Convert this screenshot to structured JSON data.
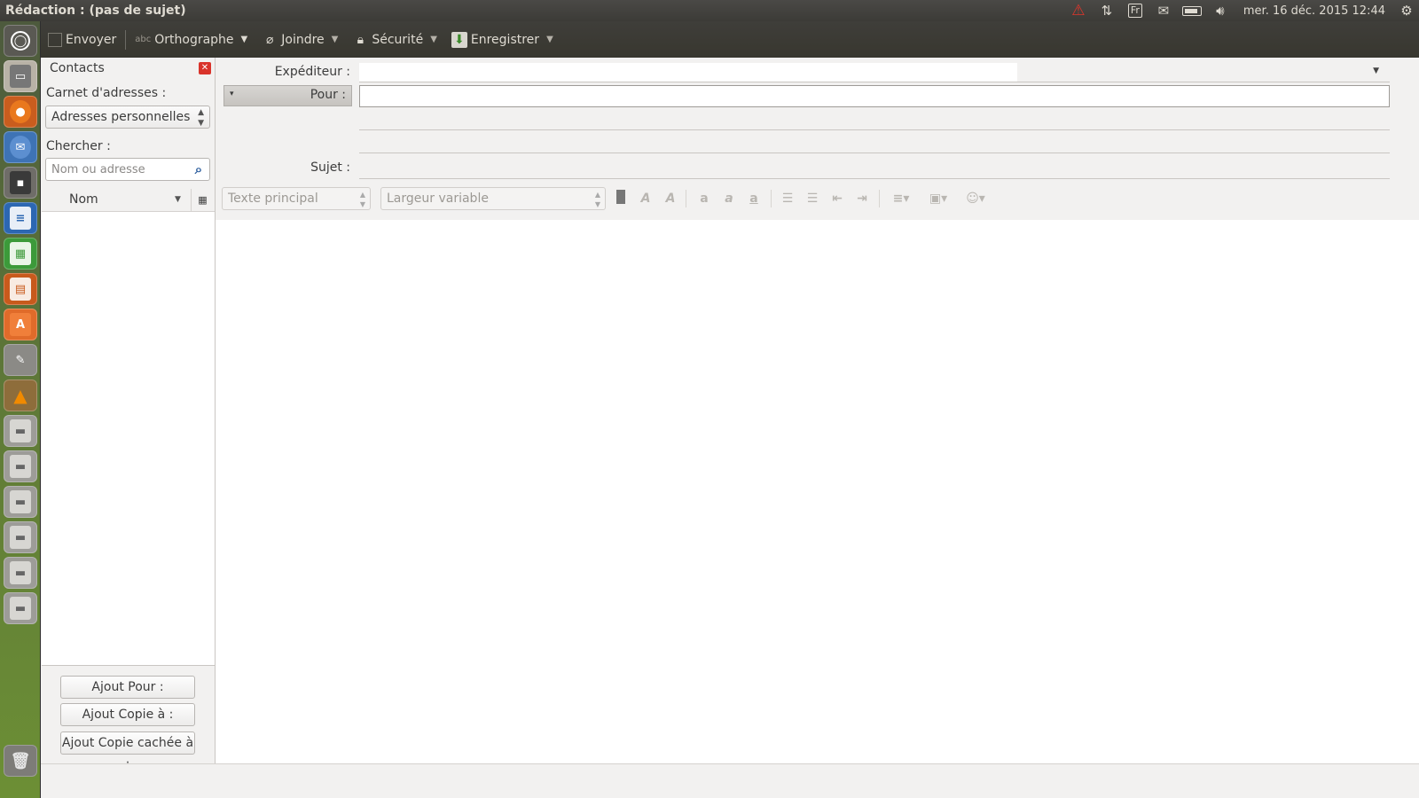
{
  "window": {
    "title": "Rédaction : (pas de sujet)"
  },
  "panel": {
    "keyboard_layout": "Fr",
    "clock": "mer. 16 déc. 2015 12:44",
    "icons": [
      "warning-icon",
      "network-icon",
      "keyboard-icon",
      "mail-icon",
      "battery-icon",
      "volume-icon",
      "gear-icon"
    ]
  },
  "launcher": {
    "items": [
      "dash-icon",
      "files-icon",
      "firefox-icon",
      "thunderbird-icon",
      "terminal-icon",
      "writer-icon",
      "calc-icon",
      "impress-icon",
      "software-center-icon",
      "settings-icon",
      "vlc-icon",
      "drive-icon",
      "drive-icon",
      "drive-icon",
      "drive-icon",
      "drive-icon",
      "drive-icon",
      "trash-icon"
    ]
  },
  "toolbar": {
    "send": "Envoyer",
    "spelling": "Orthographe",
    "attach": "Joindre",
    "security": "Sécurité",
    "save": "Enregistrer"
  },
  "contacts": {
    "title": "Contacts",
    "addressbook_label": "Carnet d'adresses :",
    "addressbook_value": "Adresses personnelles",
    "search_label": "Chercher :",
    "search_placeholder": "Nom ou adresse",
    "column_name": "Nom",
    "add_to": "Ajout Pour :",
    "add_cc": "Ajout Copie à :",
    "add_bcc": "Ajout Copie cachée à :"
  },
  "headers": {
    "from_label": "Expéditeur :",
    "to_label": "Pour :",
    "subject_label": "Sujet :"
  },
  "format": {
    "paragraph_style": "Texte principal",
    "font": "Largeur variable"
  },
  "colors": {
    "panel_bg": "#3c3b37",
    "window_bg": "#f2f1f0",
    "close_red": "#d9332a",
    "search_blue": "#2d5e9e"
  }
}
